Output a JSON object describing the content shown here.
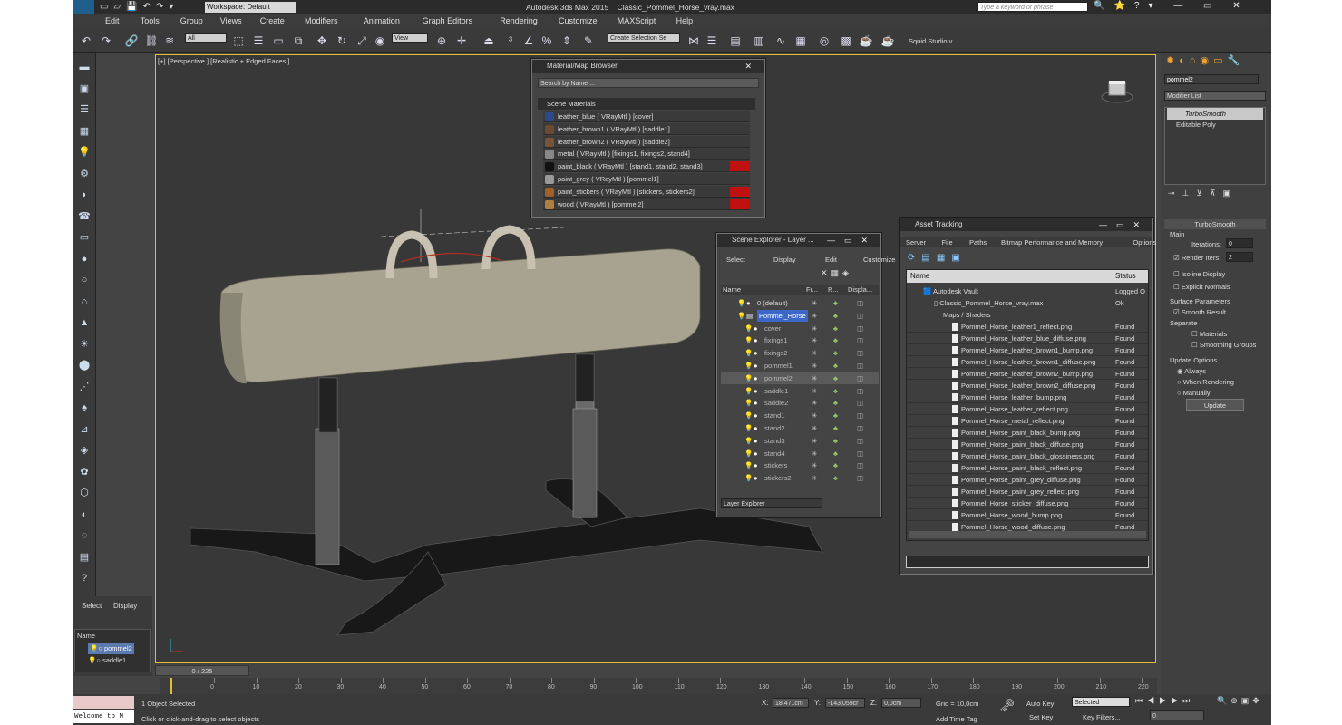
{
  "title": {
    "app": "Autodesk 3ds Max 2015",
    "file": "Classic_Pommel_Horse_vray.max",
    "search": "Type a keyword or phrase",
    "workspace": "Workspace: Default",
    "logo": "MAX"
  },
  "menu": [
    "Edit",
    "Tools",
    "Group",
    "Views",
    "Create",
    "Modifiers",
    "Animation",
    "Graph Editors",
    "Rendering",
    "Customize",
    "MAXScript",
    "Help"
  ],
  "toolbar": {
    "filter": "All",
    "ref": "View",
    "selset": "Create Selection Se",
    "project": "Squid Studio v"
  },
  "viewport": {
    "label": "[+] [Perspective ] [Realistic + Edged Faces ]"
  },
  "matbrowser": {
    "title": "Material/Map Browser",
    "search": "Search by Name ...",
    "section": "Scene Materials",
    "items": [
      "leather_blue  ( VRayMtl ) [cover]",
      "leather_brown1  ( VRayMtl ) [saddle1]",
      "leather_brown2  ( VRayMtl ) [saddle2]",
      "metal  ( VRayMtl ) [fixings1, fixings2, stand4]",
      "paint_black  ( VRayMtl ) [stand1, stand2, stand3]",
      "paint_grey  ( VRayMtl ) [pommel1]",
      "paint_stickers  ( VRayMtl ) [stickers, stickers2]",
      "wood  ( VRayMtl ) [pommel2]"
    ],
    "colors": [
      "#2a4a8a",
      "#6a4a30",
      "#7a5436",
      "#888888",
      "#111111",
      "#999999",
      "#a0602a",
      "#b08040"
    ]
  },
  "scene": {
    "title": "Scene Explorer - Layer ...",
    "menu": [
      "Select",
      "Display",
      "Edit",
      "Customize"
    ],
    "cols": [
      "Name",
      "Fr...",
      "R...",
      "Displa..."
    ],
    "layers": [
      "0 (default)",
      "Pommel_Horse"
    ],
    "objects": [
      "cover",
      "fixings1",
      "fixings2",
      "pommel1",
      "pommel2",
      "saddle1",
      "saddle2",
      "stand1",
      "stand2",
      "stand3",
      "stand4",
      "stickers",
      "stickers2"
    ],
    "footer": "Layer Explorer"
  },
  "asset": {
    "title": "Asset Tracking",
    "menu": [
      "Server",
      "File",
      "Paths",
      "Bitmap Performance and Memory",
      "Options"
    ],
    "cols": [
      "Name",
      "Status"
    ],
    "vault": "Autodesk Vault",
    "vaultStatus": "Logged O",
    "file": "Classic_Pommel_Horse_vray.max",
    "fileStatus": "Ok",
    "maps": "Maps / Shaders",
    "found": "Found",
    "files": [
      "Pommel_Horse_leather1_reflect.png",
      "Pommel_Horse_leather_blue_diffuse.png",
      "Pommel_Horse_leather_brown1_bump.png",
      "Pommel_Horse_leather_brown1_diffuse.png",
      "Pommel_Horse_leather_brown2_bump.png",
      "Pommel_Horse_leather_brown2_diffuse.png",
      "Pommel_Horse_leather_bump.png",
      "Pommel_Horse_leather_reflect.png",
      "Pommel_Horse_metal_reflect.png",
      "Pommel_Horse_paint_black_bump.png",
      "Pommel_Horse_paint_black_diffuse.png",
      "Pommel_Horse_paint_black_glossiness.png",
      "Pommel_Horse_paint_black_reflect.png",
      "Pommel_Horse_paint_grey_diffuse.png",
      "Pommel_Horse_paint_grey_reflect.png",
      "Pommel_Horse_sticker_diffuse.png",
      "Pommel_Horse_wood_bump.png",
      "Pommel_Horse_wood_diffuse.png"
    ]
  },
  "cmd": {
    "objname": "pommel2",
    "modlist": "Modifier List",
    "stack": [
      "TurboSmooth",
      "Editable Poly"
    ],
    "rollout": "TurboSmooth",
    "main": "Main",
    "iterLabel": "Iterations:",
    "iter": "0",
    "renderLabel": "Render Iters:",
    "render": "2",
    "isoline": "Isoline Display",
    "explicit": "Explicit Normals",
    "surface": "Surface Parameters",
    "smooth": "Smooth Result",
    "separate": "Separate",
    "materials": "Materials",
    "groups": "Smoothing Groups",
    "update": "Update Options",
    "always": "Always",
    "whenRendering": "When Rendering",
    "manually": "Manually",
    "updateBtn": "Update"
  },
  "leftpanel": {
    "tabs": [
      "Select",
      "Display"
    ],
    "col": "Name",
    "items": [
      "pommel2",
      "saddle1"
    ]
  },
  "time": {
    "frame": "0 / 225",
    "ticks": [
      "0",
      "10",
      "20",
      "30",
      "40",
      "50",
      "60",
      "70",
      "80",
      "90",
      "100",
      "110",
      "120",
      "130",
      "140",
      "150",
      "160",
      "170",
      "180",
      "190",
      "200",
      "210",
      "220"
    ]
  },
  "status": {
    "welcome": "Welcome to M",
    "selected": "1 Object Selected",
    "prompt": "Click or click-and-drag to select objects",
    "x": "18,471cm",
    "y": "-143,059cr",
    "z": "0,0cm",
    "grid": "Grid = 10,0cm",
    "addTime": "Add Time Tag",
    "autokey": "Auto Key",
    "setkey": "Set Key",
    "keymode": "Selected",
    "filters": "Key Filters...",
    "frameField": "0"
  }
}
